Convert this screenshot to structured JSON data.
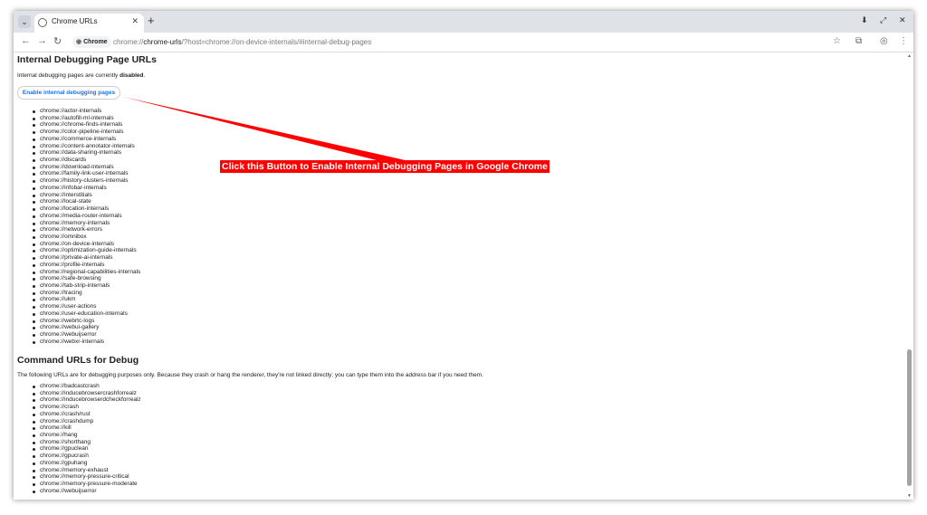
{
  "tab": {
    "title": "Chrome URLs",
    "close": "✕",
    "new_tab": "+",
    "search": "⌄"
  },
  "window_controls": {
    "download": "⬇",
    "restore": "⤢",
    "close": "✕"
  },
  "address": {
    "chip": "Chrome",
    "url_scheme": "chrome://",
    "url_host": "chrome-urls",
    "url_rest": "/?host=chrome://on-device-internals/#internal-debug-pages"
  },
  "debug_section": {
    "heading": "Internal Debugging Page URLs",
    "status_prefix": "Internal debugging pages are currently ",
    "status_value": "disabled",
    "status_suffix": ".",
    "button_label": "Enable internal debugging pages",
    "links": [
      "chrome://actor-internals",
      "chrome://autofill-ml-internals",
      "chrome://chrome-finds-internals",
      "chrome://color-pipeline-internals",
      "chrome://commerce-internals",
      "chrome://content-annotator-internals",
      "chrome://data-sharing-internals",
      "chrome://discards",
      "chrome://download-internals",
      "chrome://family-link-user-internals",
      "chrome://history-clusters-internals",
      "chrome://infobar-internals",
      "chrome://interstitials",
      "chrome://local-state",
      "chrome://location-internals",
      "chrome://media-router-internals",
      "chrome://memory-internals",
      "chrome://network-errors",
      "chrome://omnibox",
      "chrome://on-device-internals",
      "chrome://optimization-guide-internals",
      "chrome://private-ai-internals",
      "chrome://profile-internals",
      "chrome://regional-capabilities-internals",
      "chrome://safe-browsing",
      "chrome://tab-strip-internals",
      "chrome://tracing",
      "chrome://ukm",
      "chrome://user-actions",
      "chrome://user-education-internals",
      "chrome://webrtc-logs",
      "chrome://webui-gallery",
      "chrome://webuijserror",
      "chrome://webxr-internals"
    ]
  },
  "command_section": {
    "heading": "Command URLs for Debug",
    "description": "The following URLs are for debugging purposes only. Because they crash or hang the renderer, they're not linked directly; you can type them into the address bar if you need them.",
    "links": [
      "chrome://badcastcrash",
      "chrome://inducebrowsercrashforrealz",
      "chrome://inducebrowserdcheckforrealz",
      "chrome://crash",
      "chrome://crash/rust",
      "chrome://crashdump",
      "chrome://kill",
      "chrome://hang",
      "chrome://shorthang",
      "chrome://gpuclean",
      "chrome://gpucrash",
      "chrome://gpuhang",
      "chrome://memory-exhaust",
      "chrome://memory-pressure-critical",
      "chrome://memory-pressure-moderate",
      "chrome://webuijserror"
    ]
  },
  "annotation": {
    "text": "Click this Button to Enable Internal Debugging Pages in Google Chrome",
    "color": "#ff0000"
  }
}
